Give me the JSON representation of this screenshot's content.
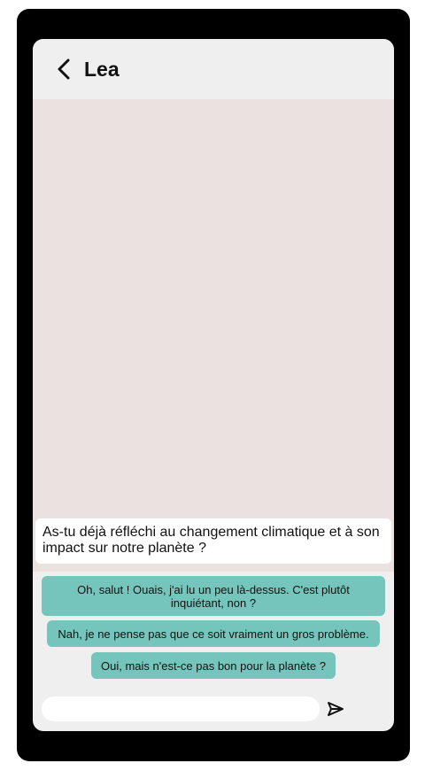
{
  "header": {
    "contact_name": "Lea",
    "back_icon": "chevron-left-icon"
  },
  "chat": {
    "incoming_message": "As-tu déjà réfléchi au changement climatique et à son impact sur notre planète ?"
  },
  "replies": [
    {
      "label": "Oh, salut ! Ouais, j'ai lu un peu là-dessus. C'est plutôt inquiétant, non ?"
    },
    {
      "label": "Nah, je ne pense pas que ce soit vraiment un gros problème."
    },
    {
      "label": "Oui, mais n'est-ce pas bon pour la planète ?"
    }
  ],
  "composer": {
    "placeholder": "",
    "send_icon": "send-icon"
  },
  "colors": {
    "device_frame": "#000000",
    "screen_bg": "#efefef",
    "chat_bg": "#ebe1e1",
    "reply_bg": "#76c5bc",
    "bubble_bg": "#ffffff"
  }
}
